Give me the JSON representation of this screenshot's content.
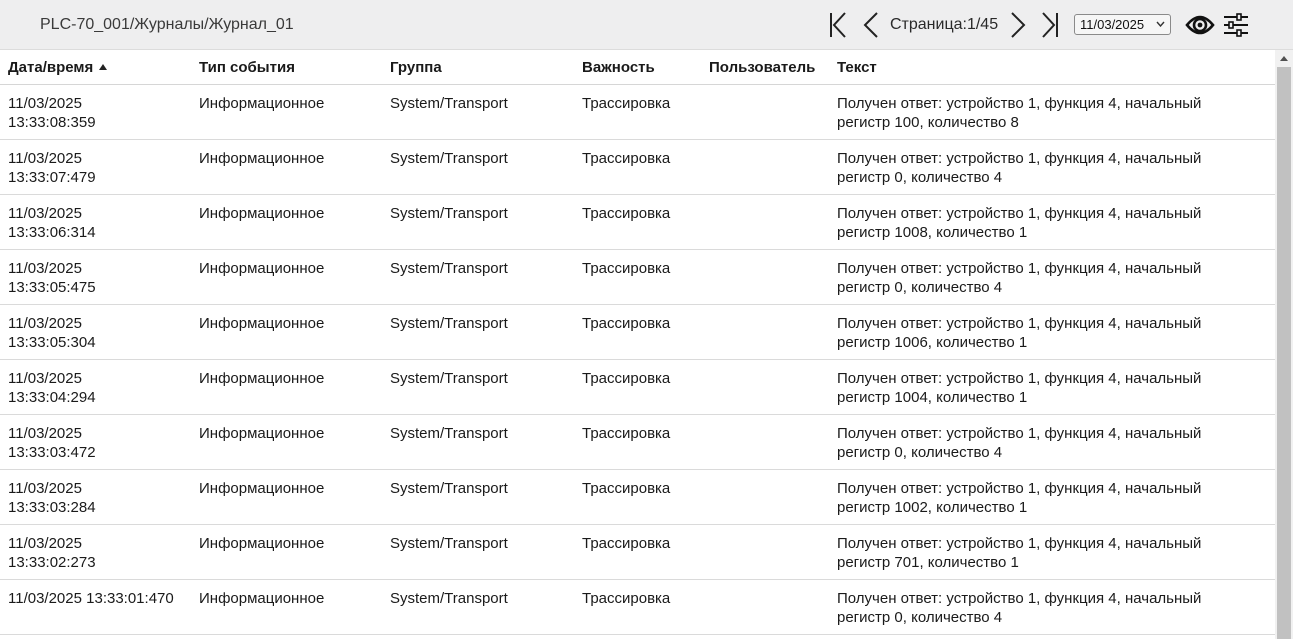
{
  "header": {
    "breadcrumb": "PLC-70_001/Журналы/Журнал_01",
    "page_label": "Страница:1/45",
    "date_value": "11/03/2025"
  },
  "icons": {
    "first": "first-page-icon",
    "prev": "prev-page-icon",
    "next": "next-page-icon",
    "last": "last-page-icon",
    "view": "eye-icon",
    "filters": "sliders-icon",
    "sort": "sort-asc-icon"
  },
  "colors": {
    "topbar": "#eeeeef",
    "row_border": "#dadada",
    "scroll_thumb": "#c1c1c1"
  },
  "table": {
    "columns": [
      "Дата/время",
      "Тип события",
      "Группа",
      "Важность",
      "Пользователь",
      "Текст"
    ],
    "rows": [
      {
        "date": "11/03/2025",
        "time": "13:33:08:359",
        "type": "Информационное",
        "group": "System/Transport",
        "severity": "Трассировка",
        "user": "",
        "text_line1": "Получен ответ: устройство 1, функция 4, начальный",
        "text_line2": "регистр 100, количество 8"
      },
      {
        "date": "11/03/2025",
        "time": "13:33:07:479",
        "type": "Информационное",
        "group": "System/Transport",
        "severity": "Трассировка",
        "user": "",
        "text_line1": "Получен ответ: устройство 1, функция 4, начальный",
        "text_line2": "регистр 0, количество 4"
      },
      {
        "date": "11/03/2025",
        "time": "13:33:06:314",
        "type": "Информационное",
        "group": "System/Transport",
        "severity": "Трассировка",
        "user": "",
        "text_line1": "Получен ответ: устройство 1, функция 4, начальный",
        "text_line2": "регистр 1008, количество 1"
      },
      {
        "date": "11/03/2025",
        "time": "13:33:05:475",
        "type": "Информационное",
        "group": "System/Transport",
        "severity": "Трассировка",
        "user": "",
        "text_line1": "Получен ответ: устройство 1, функция 4, начальный",
        "text_line2": "регистр 0, количество 4"
      },
      {
        "date": "11/03/2025",
        "time": "13:33:05:304",
        "type": "Информационное",
        "group": "System/Transport",
        "severity": "Трассировка",
        "user": "",
        "text_line1": "Получен ответ: устройство 1, функция 4, начальный",
        "text_line2": "регистр 1006, количество 1"
      },
      {
        "date": "11/03/2025",
        "time": "13:33:04:294",
        "type": "Информационное",
        "group": "System/Transport",
        "severity": "Трассировка",
        "user": "",
        "text_line1": "Получен ответ: устройство 1, функция 4, начальный",
        "text_line2": "регистр 1004, количество 1"
      },
      {
        "date": "11/03/2025",
        "time": "13:33:03:472",
        "type": "Информационное",
        "group": "System/Transport",
        "severity": "Трассировка",
        "user": "",
        "text_line1": "Получен ответ: устройство 1, функция 4, начальный",
        "text_line2": "регистр 0, количество 4"
      },
      {
        "date": "11/03/2025",
        "time": "13:33:03:284",
        "type": "Информационное",
        "group": "System/Transport",
        "severity": "Трассировка",
        "user": "",
        "text_line1": "Получен ответ: устройство 1, функция 4, начальный",
        "text_line2": "регистр 1002, количество 1"
      },
      {
        "date": "11/03/2025",
        "time": "13:33:02:273",
        "type": "Информационное",
        "group": "System/Transport",
        "severity": "Трассировка",
        "user": "",
        "text_line1": "Получен ответ: устройство 1, функция 4, начальный",
        "text_line2": "регистр 701, количество 1"
      },
      {
        "date": "11/03/2025",
        "time": "13:33:01:470",
        "type": "Информационное",
        "group": "System/Transport",
        "severity": "Трассировка",
        "user": "",
        "text_line1": "Получен ответ: устройство 1, функция 4, начальный",
        "text_line2": "регистр 0, количество 4"
      }
    ]
  }
}
